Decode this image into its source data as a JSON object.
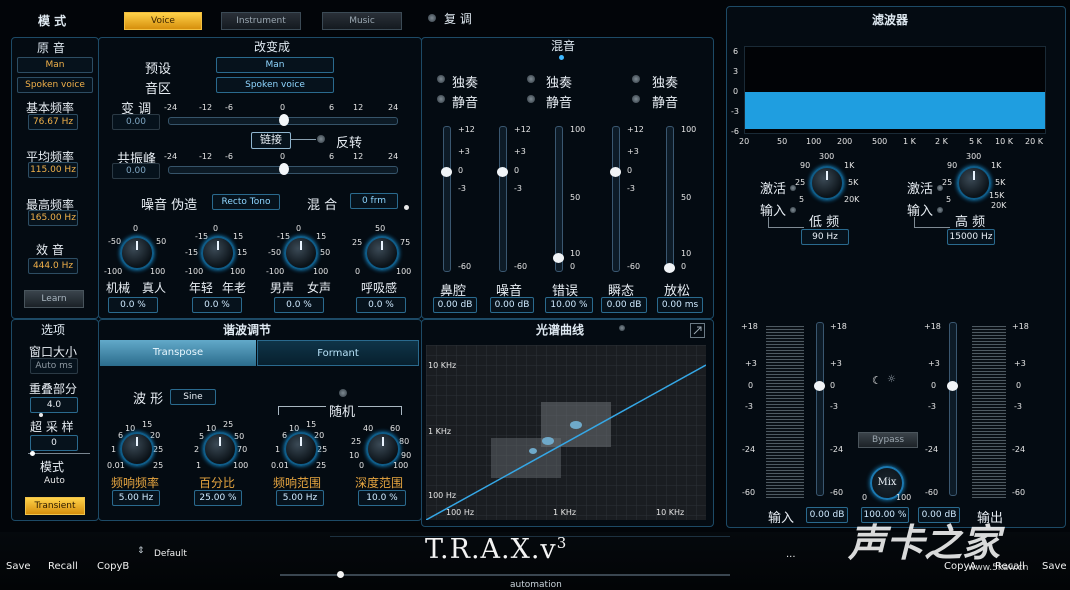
{
  "header": {
    "mode_label": "模 式",
    "mode_tabs": [
      {
        "label": "Voice",
        "active": true
      },
      {
        "label": "Instrument",
        "active": false
      },
      {
        "label": "Music",
        "active": false
      }
    ],
    "restore_label": "复 调"
  },
  "original": {
    "title": "原 音",
    "gender": "Man",
    "preset": "Spoken voice",
    "base_freq_label": "基本频率",
    "base_freq": "76.67 Hz",
    "avg_freq_label": "平均频率",
    "avg_freq": "115.00 Hz",
    "max_freq_label": "最高频率",
    "max_freq": "165.00 Hz",
    "effect_label": "效 音",
    "effect_freq": "444.0 Hz",
    "learn_label": "Learn"
  },
  "transform": {
    "title": "改变成",
    "preset_label": "预设",
    "preset_value": "Man",
    "range_label": "音区",
    "range_value": "Spoken voice",
    "pitch_label": "变 调",
    "pitch_value": "0.00",
    "link_label": "链接",
    "invert_label": "反转",
    "formant_label": "共振峰",
    "formant_value": "0.00",
    "scale_ticks": [
      "-24",
      "-12",
      "-6",
      "0",
      "6",
      "12",
      "24"
    ],
    "noise_label": "噪音 伪造",
    "noise_value": "Recto Tono",
    "mix_label": "混 合",
    "mix_value": "0 frm",
    "knobs": [
      {
        "lt": "0",
        "l": "-50",
        "r": "50",
        "bl": "-100",
        "br": "100",
        "label_a": "机械",
        "label_b": "真人",
        "value": "0.0 %"
      },
      {
        "lt": "0",
        "l": "-15",
        "r": "15",
        "tl": "-15",
        "tr": "15",
        "bl": "-50",
        "br": "50",
        "label_a": "年轻",
        "label_b": "年老",
        "value": "0.0 %",
        "ll": "-100",
        "rr": "100"
      },
      {
        "lt": "0",
        "tl": "-15",
        "tr": "15",
        "l": "-50",
        "r": "50",
        "bl": "-100",
        "br": "100",
        "label_a": "男声",
        "label_b": "女声",
        "value": "0.0 %"
      },
      {
        "lt": "50",
        "l": "25",
        "r": "75",
        "bl": "0",
        "br": "100",
        "label_a": "呼吸感",
        "label_b": "",
        "value": "0.0 %"
      }
    ]
  },
  "mixer": {
    "title": "混音",
    "solo_label": "独奏",
    "mute_label": "静音",
    "db_ticks": [
      "+12",
      "+3",
      "0",
      "-3",
      "-60"
    ],
    "pct_ticks": [
      "100",
      "50",
      "10",
      "0"
    ],
    "channels": [
      {
        "label": "鼻腔",
        "value": "0.00 dB"
      },
      {
        "label": "噪音",
        "value": "0.00 dB"
      },
      {
        "label": "错误",
        "value": "10.00 %"
      },
      {
        "label": "瞬态",
        "value": "0.00 dB"
      },
      {
        "label": "放松",
        "value": "0.00 ms"
      }
    ]
  },
  "options": {
    "title": "选项",
    "window_label": "窗口大小",
    "window_value": "Auto ms",
    "overlap_label": "重叠部分",
    "overlap_value": "4.0",
    "oversample_label": "超 采 样",
    "oversample_value": "0",
    "mode_label": "模式",
    "mode_value": "Auto",
    "transient_label": "Transient"
  },
  "harmonic": {
    "title": "谐波调节",
    "tabs": [
      {
        "label": "Transpose",
        "active": true
      },
      {
        "label": "Formant",
        "active": false
      }
    ],
    "wave_label": "波 形",
    "wave_value": "Sine",
    "random_label": "随机",
    "knobs": [
      {
        "label": "频响频率",
        "value": "5.00 Hz",
        "t": [
          "10",
          "15"
        ],
        "l": [
          "6",
          "1"
        ],
        "r": [
          "20",
          "25"
        ],
        "b": [
          "0.01",
          "25"
        ]
      },
      {
        "label": "百分比",
        "value": "25.00 %",
        "t": [
          "10",
          "25"
        ],
        "l": [
          "5",
          "2"
        ],
        "r": [
          "50",
          "70"
        ],
        "b": [
          "1",
          "100"
        ]
      },
      {
        "label": "频响范围",
        "value": "5.00 Hz",
        "t": [
          "10",
          "15"
        ],
        "l": [
          "6",
          "1"
        ],
        "r": [
          "20",
          "25"
        ],
        "b": [
          "0.01",
          "25"
        ]
      },
      {
        "label": "深度范围",
        "value": "10.0 %",
        "t": [
          "40",
          "60"
        ],
        "l": [
          "25",
          "10"
        ],
        "r": [
          "80",
          "90"
        ],
        "b": [
          "0",
          "100"
        ]
      }
    ]
  },
  "spectrum": {
    "title": "光谱曲线",
    "y_labels": [
      "10 KHz",
      "1 KHz",
      "100 Hz"
    ],
    "x_labels": [
      "100 Hz",
      "1 KHz",
      "10 KHz"
    ]
  },
  "filter": {
    "title": "滤波器",
    "y_ticks": [
      "6",
      "3",
      "0",
      "-3",
      "-6"
    ],
    "x_ticks": [
      "20",
      "50",
      "100",
      "200",
      "500",
      "1 K",
      "2 K",
      "5 K",
      "10 K",
      "20 K"
    ],
    "low": {
      "activate_label": "激活",
      "input_label": "输入",
      "name": "低 频",
      "value": "90 Hz",
      "ticks": {
        "t": "300",
        "tl": "90",
        "tr": "1K",
        "l": "25",
        "r": "5K",
        "bl": "5",
        "br": "20K"
      }
    },
    "high": {
      "activate_label": "激活",
      "input_label": "输入",
      "name": "高 频",
      "value": "15000 Hz",
      "ticks": {
        "t": "300",
        "tl": "90",
        "tr": "1K",
        "l": "25",
        "r": "5K",
        "rr": "15K",
        "bl": "5",
        "br": "20K"
      }
    },
    "meter_ticks": [
      "+18",
      "+3",
      "0",
      "-3",
      "-24",
      "-60"
    ],
    "bypass_label": "Bypass",
    "mix_label": "Mix",
    "mix_min": "0",
    "mix_max": "100",
    "in_label": "输入",
    "in_value": "0.00 dB",
    "mix_value": "100.00 %",
    "out_value": "0.00 dB",
    "out_label": "输出"
  },
  "footer": {
    "save": "Save",
    "recall": "Recall",
    "copy": "CopyB",
    "preset": "Default",
    "logo": "T.R.A.X.v",
    "logo_sup": "3",
    "ellipsis": "...",
    "automation": "automation",
    "copy_r": "CopyA",
    "recall_r": "Recall",
    "save_r": "Save"
  },
  "watermark": {
    "text": "声卡之家",
    "url": "www.5kaw.cn"
  }
}
